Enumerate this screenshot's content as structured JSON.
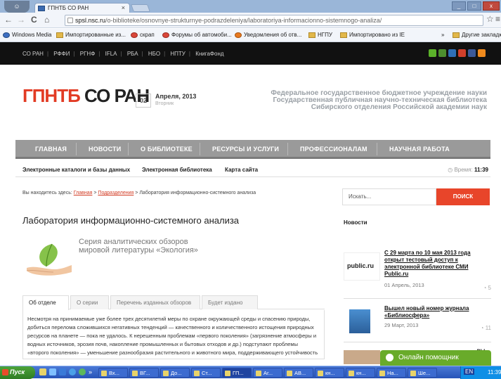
{
  "browser": {
    "tab_title": "ГПНТБ СО РАН",
    "tab_close": "×",
    "url_domain": "spsl.nsc.ru",
    "url_path": "/o-biblioteke/osnovnye-strukturnye-podrazdeleniya/laboratoriya-informacionno-sistemnogo-analiza/",
    "back_glyph": "←",
    "forward_glyph": "→",
    "reload_glyph": "C",
    "home_glyph": "⌂",
    "star_glyph": "☆",
    "menu_glyph": "≡",
    "bookmarks": [
      "Windows Media",
      "Импортированные из...",
      "скрап",
      "Форумы об автомоби...",
      "Уведомления об отв...",
      "НГПУ",
      "Импортировано из IE"
    ],
    "bookmarks_more": "»",
    "bookmarks_other": "Другие закладки"
  },
  "site": {
    "top_links": [
      "СО РАН",
      "РФФИ",
      "РГНФ",
      "IFLA",
      "РБА",
      "НБО",
      "НПТУ",
      "КнигаФонд"
    ],
    "logo_red": "ГПНТБ",
    "logo_dark": "СО РАН",
    "date_day": "02",
    "date_month": "Апреля, 2013",
    "date_weekday": "Вторник",
    "tagline": [
      "Федеральное государственное бюджетное учреждение науки",
      "Государственная публичная научно-техническая библиотека",
      "Сибирского отделения Российской академии наук"
    ],
    "main_nav": [
      "ГЛАВНАЯ",
      "НОВОСТИ",
      "О БИБЛИОТЕКЕ",
      "РЕСУРСЫ И УСЛУГИ",
      "ПРОФЕССИОНАЛАМ",
      "НАУЧНАЯ РАБОТА"
    ],
    "sub_nav": [
      "Электронные каталоги и базы данных",
      "Электронная библиотека",
      "Карта сайта"
    ],
    "clock_label": "Время:",
    "clock_value": "11:39"
  },
  "breadcrumb": {
    "prefix": "Вы находитесь здесь:",
    "home": "Главная",
    "sep": ">",
    "section": "Подразделения",
    "current": "Лаборатория информационно-системного анализа"
  },
  "page": {
    "title": "Лаборатория информационно-системного анализа",
    "series_line1": "Серия аналитических обзоров",
    "series_line2": "мировой литературы «Экология»",
    "tabs": [
      "Об отделе",
      "О серии",
      "Перечень изданных обзоров",
      "Будет издано"
    ],
    "body": "Несмотря на принимаемые уже более трех десятилетий меры по охране окружающей среды и спасению природы, добиться перелома сложившихся негативных тенденций — качественного и количественного истощения природных ресурсов на планете — пока не удалось. К нерешенным проблемам «первого поколения» (загрязнение атмосферы и водных источников, эрозия почв, накопление промышленных и бытовых отходов и др.) подступают проблемы «второго поколения» — уменьшение разнообразия растительного и животного мира, поддерживающего устойчивость"
  },
  "sidebar": {
    "search_placeholder": "Искать...",
    "search_button": "ПОИСК",
    "news_heading": "Новости",
    "news": [
      {
        "title": "С 29 марта по 10 мая 2013 года открыт тестовый доступ к электронной библиотеке СМИ Public.ru",
        "date": "01 Апрель, 2013",
        "count": "5",
        "logo": "public.ru"
      },
      {
        "title": "Вышел новый номер журнала «Библиосфера»",
        "date": "29 Март, 2013",
        "count": "11"
      },
      {
        "title": "...ры",
        "date": ""
      }
    ],
    "helper": "Онлайн помощник"
  },
  "taskbar": {
    "start": "Пуск",
    "quick_more": "»",
    "items": [
      "Вх...",
      "ВГ...",
      "До...",
      "Ст...",
      "ГП...",
      "Аг...",
      "АВ...",
      "кн...",
      "кн...",
      "На...",
      "Ше..."
    ],
    "tray_lang": "EN",
    "time": "11:39"
  },
  "colors": {
    "accent_red": "#e23b24",
    "nav_gray": "#9a9a9a",
    "helper_green": "#69ab2a"
  }
}
